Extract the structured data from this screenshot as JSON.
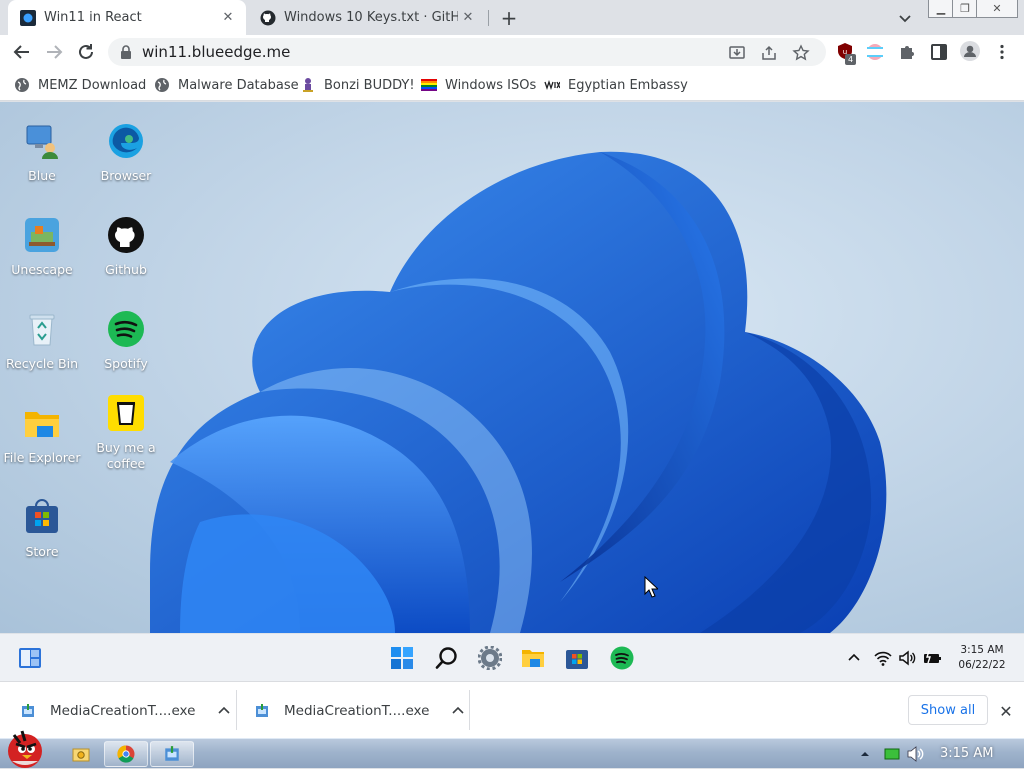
{
  "browser": {
    "tabs": [
      {
        "title": "Win11 in React",
        "icon": "win11-favicon",
        "active": true
      },
      {
        "title": "Windows 10 Keys.txt · GitHub",
        "icon": "github-icon",
        "active": false
      }
    ],
    "address": "win11.blueedge.me",
    "extension_badge": "4",
    "bookmarks": [
      {
        "label": "MEMZ Download",
        "icon": "globe-icon"
      },
      {
        "label": "Malware Database",
        "icon": "globe-icon"
      },
      {
        "label": "Bonzi BUDDY!",
        "icon": "bonzi-icon"
      },
      {
        "label": "Windows ISOs",
        "icon": "rainbow-flag-icon"
      },
      {
        "label": "Egyptian Embassy",
        "icon": "wix-icon"
      }
    ]
  },
  "desktop": {
    "icons": [
      {
        "label": "Blue",
        "icon": "user-pc-icon"
      },
      {
        "label": "Browser",
        "icon": "edge-icon"
      },
      {
        "label": "Unescape",
        "icon": "unescape-icon"
      },
      {
        "label": "Github",
        "icon": "github-icon"
      },
      {
        "label": "Recycle Bin",
        "icon": "recycle-bin-icon"
      },
      {
        "label": "Spotify",
        "icon": "spotify-icon"
      },
      {
        "label": "File Explorer",
        "icon": "folder-icon"
      },
      {
        "label": "Buy me a coffee",
        "icon": "coffee-icon"
      },
      {
        "label": "Store",
        "icon": "store-icon"
      }
    ]
  },
  "taskbar": {
    "apps": [
      "start-icon",
      "search-icon",
      "settings-icon",
      "file-explorer-icon",
      "store-icon",
      "spotify-icon"
    ],
    "time": "3:15 AM",
    "date": "06/22/22"
  },
  "downloads": {
    "items": [
      {
        "name": "MediaCreationT....exe"
      },
      {
        "name": "MediaCreationT....exe"
      }
    ],
    "show_all": "Show all"
  },
  "host_taskbar": {
    "time": "3:15 AM"
  },
  "colors": {
    "accent": "#1a73e8",
    "bloom_blue": "#1f6fe0",
    "spotify": "#1db954"
  }
}
